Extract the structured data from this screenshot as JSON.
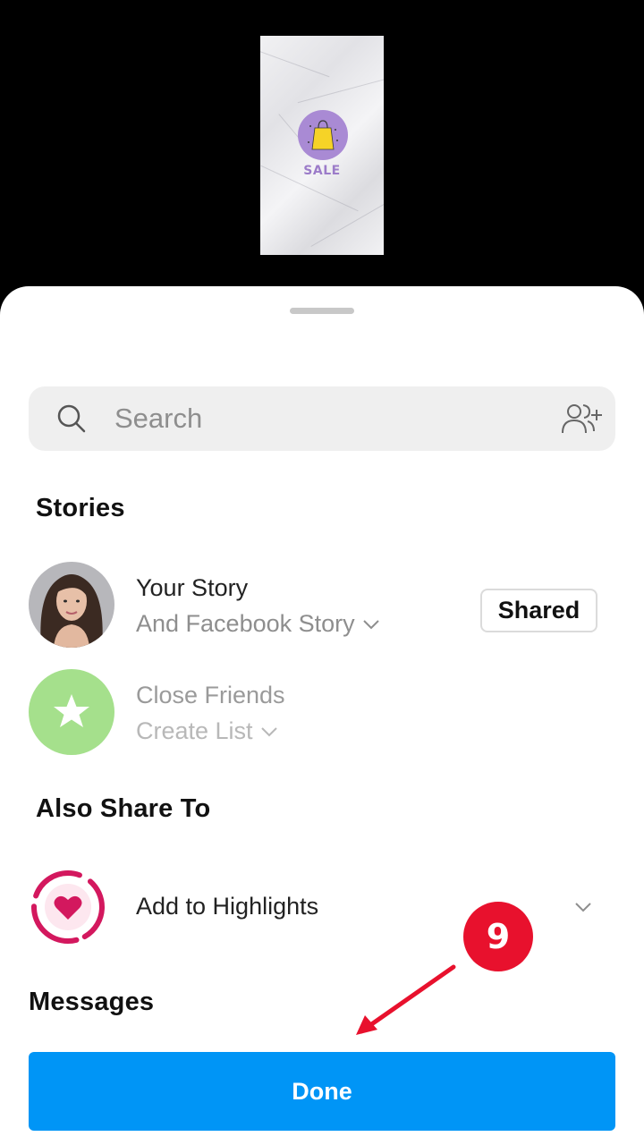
{
  "preview": {
    "sale_text": "SALE",
    "icon": "shopping-bag-icon"
  },
  "search": {
    "placeholder": "Search",
    "icons": [
      "search-icon",
      "add-people-icon"
    ]
  },
  "sections": {
    "stories": "Stories",
    "also_share_to": "Also Share To",
    "messages": "Messages"
  },
  "stories": {
    "your_story": {
      "title": "Your Story",
      "subtitle": "And Facebook Story",
      "button": "Shared"
    },
    "close_friends": {
      "title": "Close Friends",
      "subtitle": "Create List"
    }
  },
  "also_share": {
    "highlights": {
      "title": "Add to Highlights"
    }
  },
  "footer": {
    "done_label": "Done"
  },
  "annotation": {
    "step_number": "9",
    "color": "#e8112d"
  },
  "colors": {
    "primary": "#0095f6",
    "close_friends": "#a5e08c",
    "highlight": "#d3185e"
  }
}
